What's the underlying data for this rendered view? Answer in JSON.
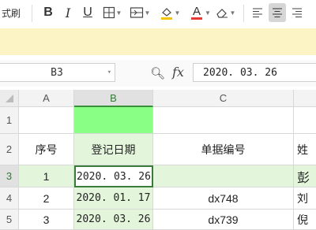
{
  "toolbar": {
    "format_painter_label": "式刷",
    "bold": "B",
    "italic": "I",
    "underline": "U",
    "font_color_glyph": "A",
    "font_color": "#e53935",
    "highlight_color": "#f5c400"
  },
  "formula_bar": {
    "name_box": "B3",
    "fx_label": "fx",
    "formula_value": "2020. 03. 26"
  },
  "sheet": {
    "columns": [
      "A",
      "B",
      "C"
    ],
    "rows": [
      "1",
      "2",
      "3",
      "4",
      "5"
    ],
    "headers": {
      "seq": "序号",
      "reg_date": "登记日期",
      "doc_no": "单据编号",
      "partial": "姓"
    },
    "data": [
      {
        "seq": "1",
        "date": "2020. 03. 26",
        "doc": "",
        "name_partial": "彭"
      },
      {
        "seq": "2",
        "date": "2020. 01. 17",
        "doc": "dx748",
        "name_partial": "刘"
      },
      {
        "seq": "3",
        "date": "2020. 03. 26",
        "doc": "dx739",
        "name_partial": "倪"
      }
    ],
    "highlight_color": "#8aff85",
    "selected_row_tint": "#e3f6dc"
  }
}
